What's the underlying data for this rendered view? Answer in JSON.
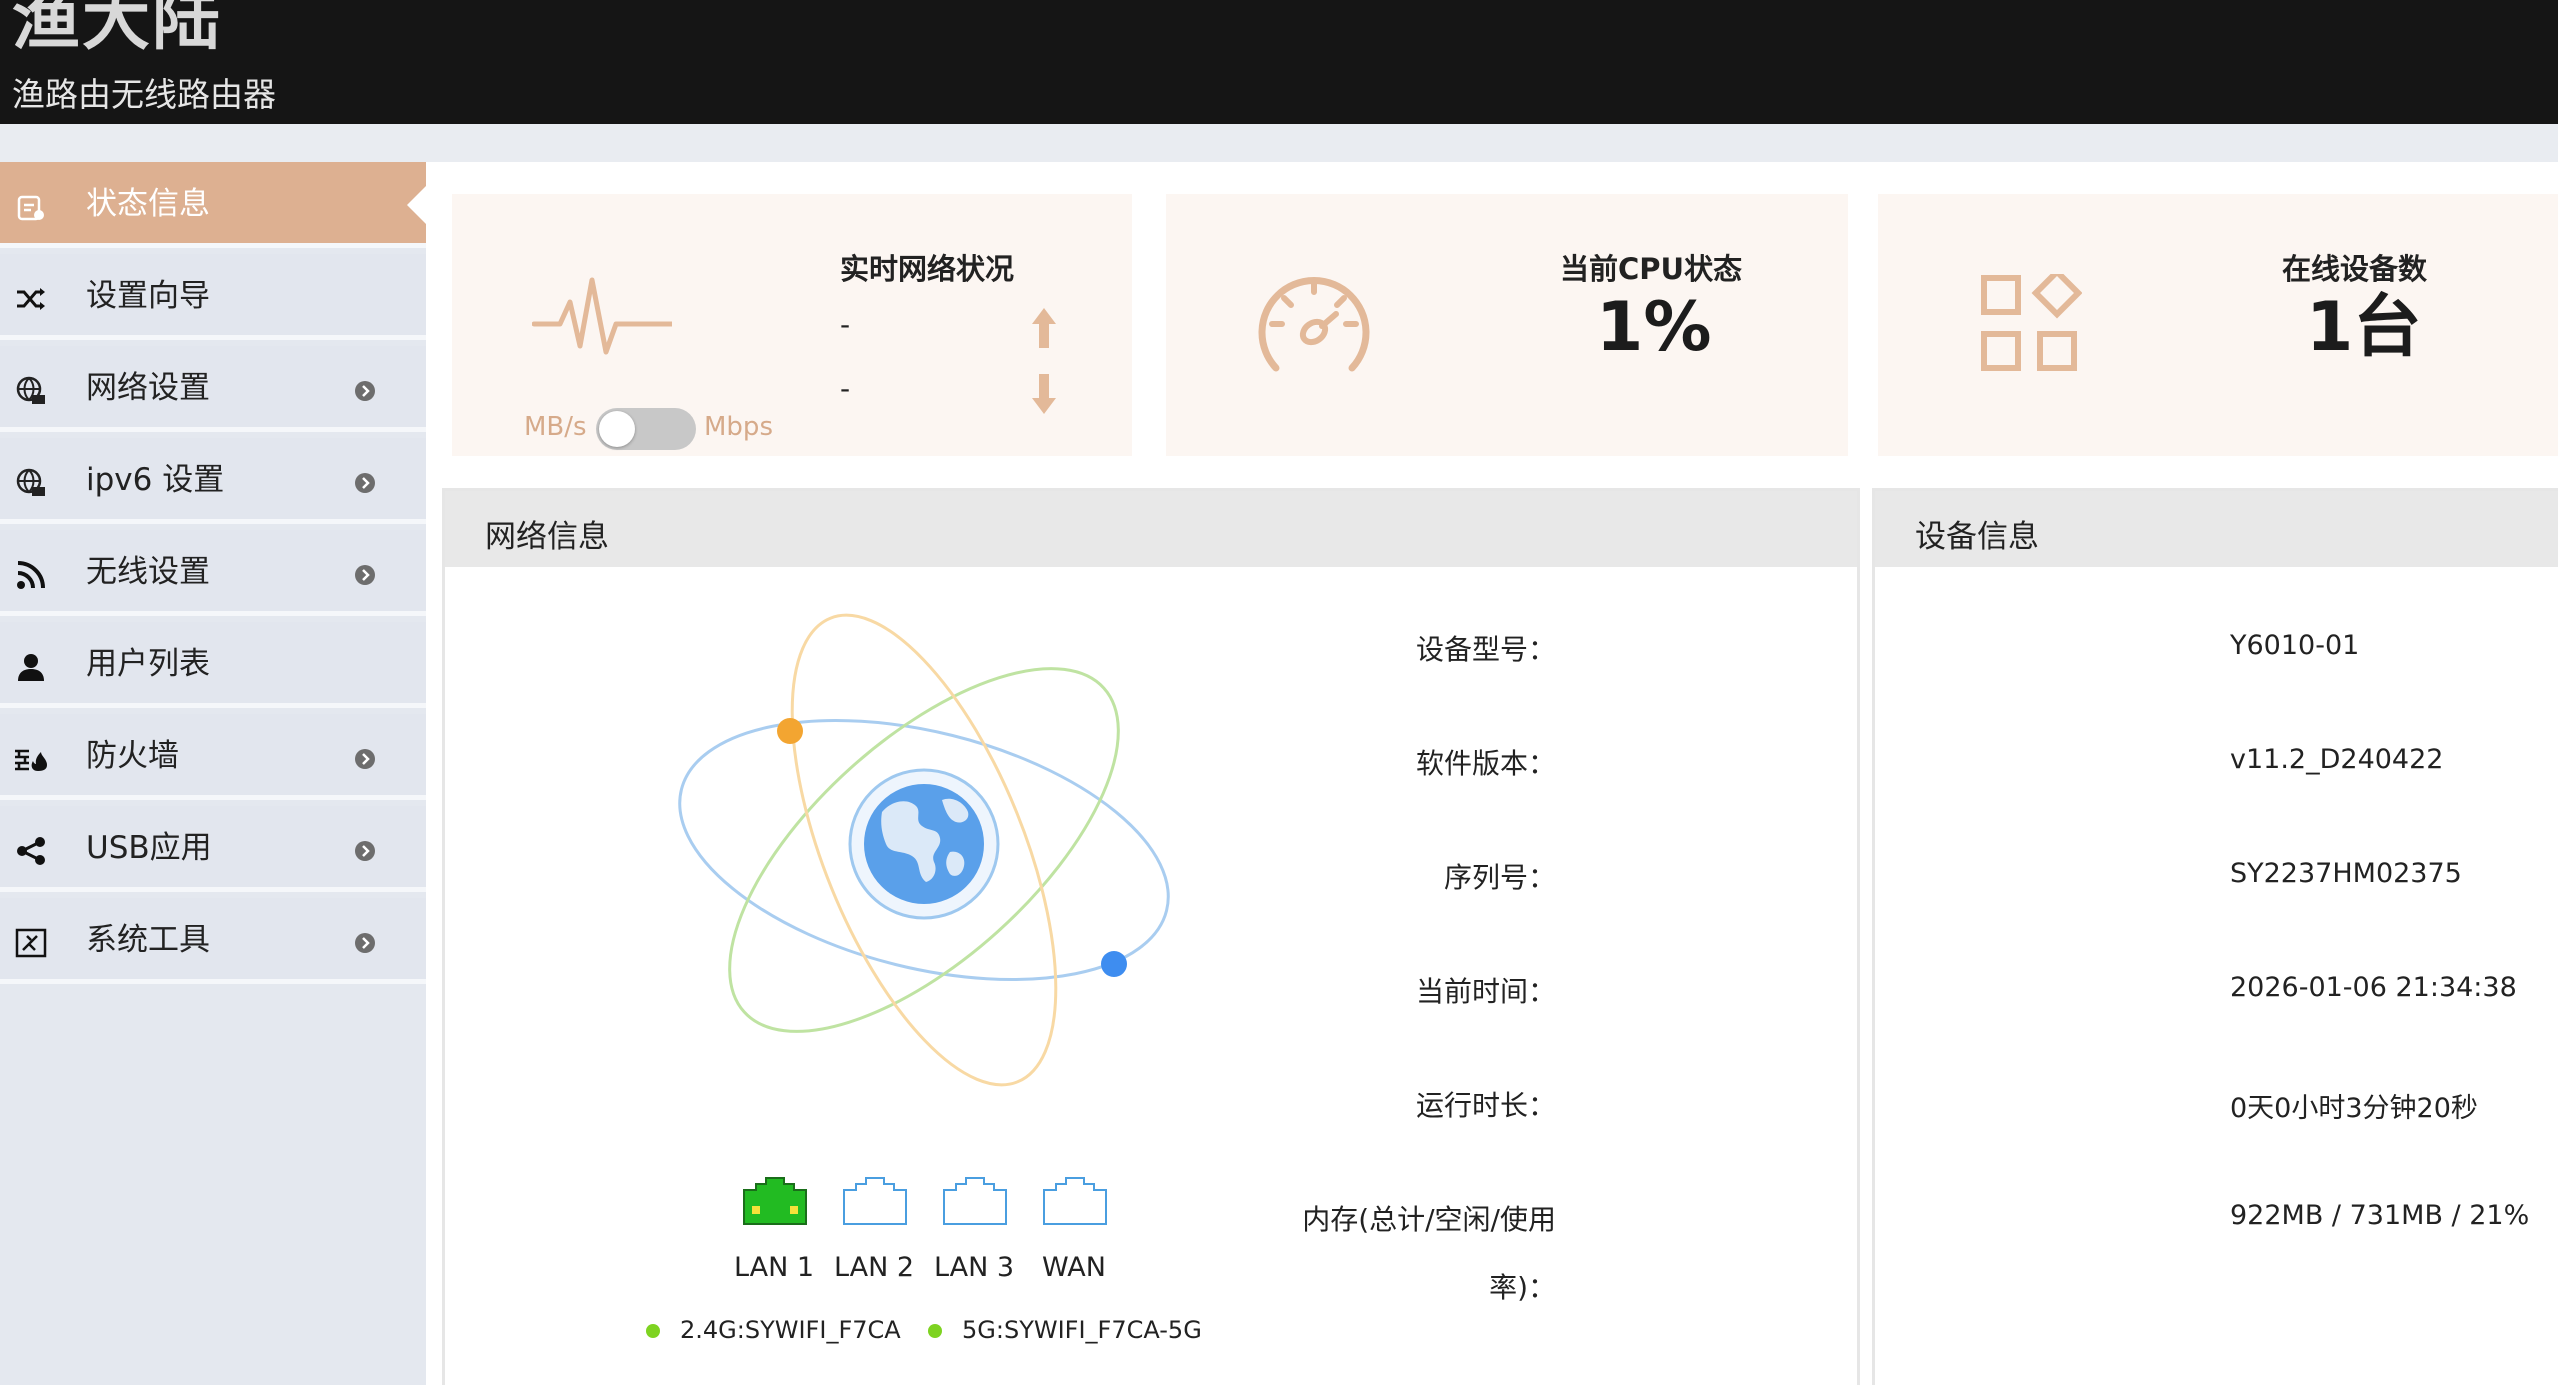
{
  "header": {
    "logo_text": "渔大陆",
    "subtitle": "渔路由无线路由器"
  },
  "sidebar": {
    "items": [
      {
        "label": "状态信息",
        "icon": "dashboard-icon",
        "active": true,
        "has_submenu": false
      },
      {
        "label": "设置向导",
        "icon": "shuffle-icon",
        "active": false,
        "has_submenu": false
      },
      {
        "label": "网络设置",
        "icon": "globe-network-icon",
        "active": false,
        "has_submenu": true
      },
      {
        "label": "ipv6 设置",
        "icon": "globe-network-icon",
        "active": false,
        "has_submenu": true
      },
      {
        "label": "无线设置",
        "icon": "wifi-signal-icon",
        "active": false,
        "has_submenu": true
      },
      {
        "label": "用户列表",
        "icon": "user-icon",
        "active": false,
        "has_submenu": false
      },
      {
        "label": "防火墙",
        "icon": "firewall-icon",
        "active": false,
        "has_submenu": true
      },
      {
        "label": "USB应用",
        "icon": "share-icon",
        "active": false,
        "has_submenu": true
      },
      {
        "label": "系统工具",
        "icon": "tools-icon",
        "active": false,
        "has_submenu": true
      }
    ]
  },
  "cards": {
    "network": {
      "title": "实时网络状况",
      "upload": "-",
      "download": "-",
      "unit_left": "MB/s",
      "unit_right": "Mbps",
      "toggle_on": false
    },
    "cpu": {
      "title": "当前CPU状态",
      "value": "1%"
    },
    "devices": {
      "title": "在线设备数",
      "value": "1台"
    }
  },
  "network_panel": {
    "title": "网络信息",
    "ports": [
      {
        "label": "LAN 1",
        "connected": true
      },
      {
        "label": "LAN 2",
        "connected": false
      },
      {
        "label": "LAN 3",
        "connected": false
      },
      {
        "label": "WAN",
        "connected": false
      }
    ],
    "ssids": [
      "2.4G:SYWIFI_F7CA",
      "5G:SYWIFI_F7CA-5G"
    ]
  },
  "device_panel": {
    "title": "设备信息",
    "rows": [
      {
        "label": "设备型号：",
        "value": "Y6010-01"
      },
      {
        "label": "软件版本：",
        "value": "v11.2_D240422"
      },
      {
        "label": "序列号：",
        "value": "SY2237HM02375"
      },
      {
        "label": "当前时间：",
        "value": "2026-01-06 21:34:38"
      },
      {
        "label": "运行时长：",
        "value": "0天0小时3分钟20秒"
      },
      {
        "label": "内存(总计/空闲/使用",
        "label_cont": "率)：",
        "value": "922MB / 731MB / 21%"
      }
    ]
  },
  "colors": {
    "accent": "#ddb091",
    "card_bg": "#fcf6f2",
    "icon_tan": "#e3b999",
    "port_active": "#22bb22",
    "port_idle": "#4a9ee0",
    "ssid_dot": "#7ed321"
  }
}
